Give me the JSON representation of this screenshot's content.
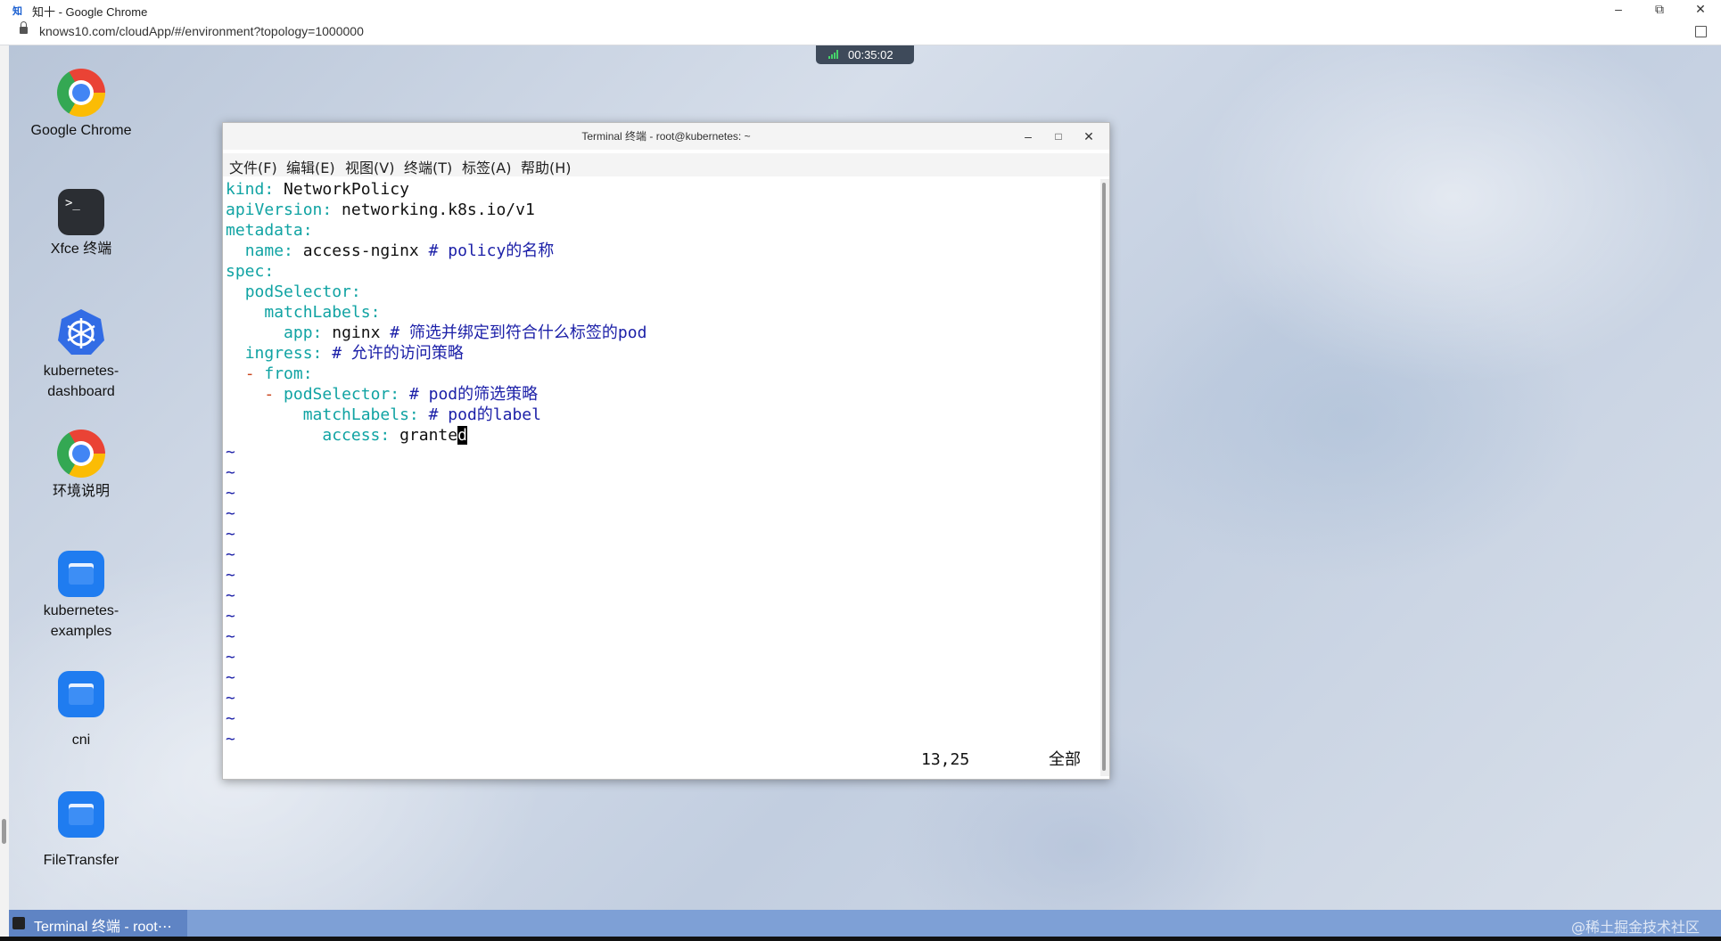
{
  "browser": {
    "favicon": "知",
    "title": "知十 - Google Chrome",
    "url": "knows10.com/cloudApp/#/environment?topology=1000000",
    "controls": {
      "minimize": "–",
      "restore": "⧉",
      "close": "✕"
    }
  },
  "session_timer": "00:35:02",
  "desktop_icons": [
    {
      "label": "Google Chrome",
      "icon": "chrome-icon"
    },
    {
      "label": "Xfce 终端",
      "icon": "terminal-icon"
    },
    {
      "label": "kubernetes-dashboard",
      "icon": "kubernetes-icon"
    },
    {
      "label": "环境说明",
      "icon": "chrome-icon"
    },
    {
      "label": "kubernetes-examples",
      "icon": "folder-icon"
    },
    {
      "label": "cni",
      "icon": "folder-icon"
    },
    {
      "label": "FileTransfer",
      "icon": "folder-icon"
    }
  ],
  "terminal": {
    "title": "Terminal 终端 - root@kubernetes: ~",
    "controls": {
      "minimize": "–",
      "maximize": "□",
      "close": "✕"
    },
    "menu": [
      "文件(F)",
      "编辑(E)",
      "视图(V)",
      "终端(T)",
      "标签(A)",
      "帮助(H)"
    ],
    "lines": [
      "kind: NetworkPolicy",
      "apiVersion: networking.k8s.io/v1",
      "metadata:",
      "  name: access-nginx # policy的名称",
      "spec:",
      "  podSelector:",
      "    matchLabels:",
      "      app: nginx # 筛选并绑定到符合什么标签的pod",
      "  ingress: # 允许的访问策略",
      "  - from:",
      "    - podSelector: # pod的筛选策略",
      "        matchLabels: # pod的label",
      "          access: granted"
    ],
    "empty_line_marker": "~",
    "empty_line_count": 15,
    "status_position": "13,25",
    "status_scope": "全部"
  },
  "taskbar": {
    "item_label": "Terminal 终端 - root⋯"
  },
  "watermark": "@稀土掘金技术社区"
}
